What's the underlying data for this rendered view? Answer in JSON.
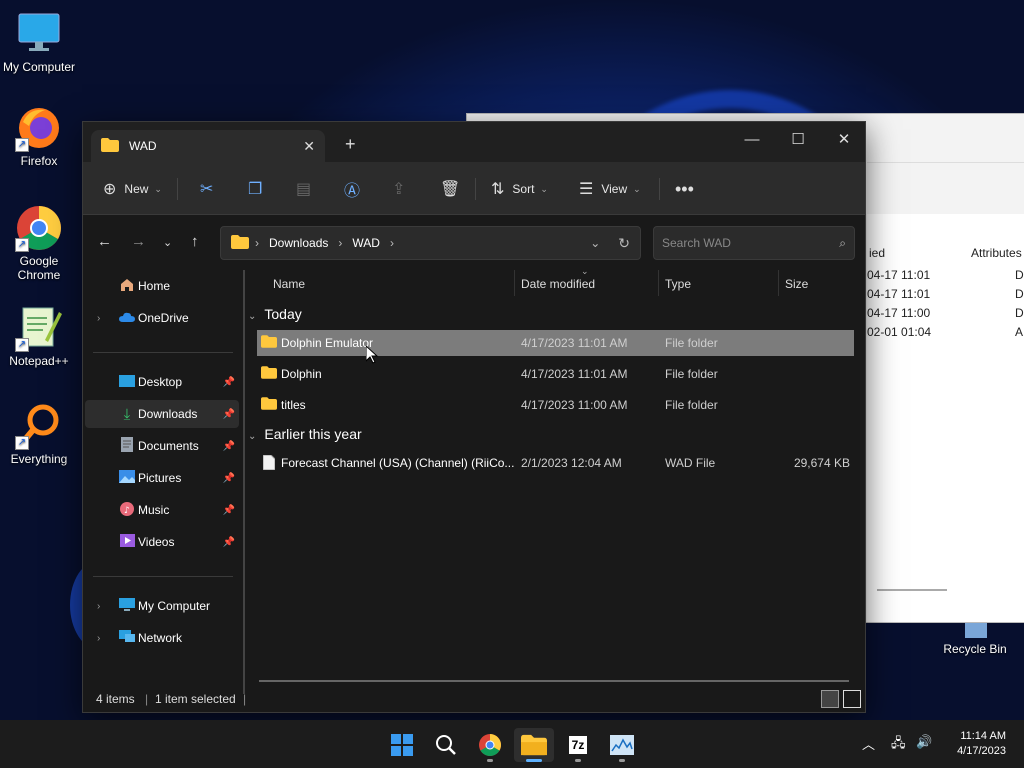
{
  "desktop": {
    "icons": [
      {
        "label": "My Computer"
      },
      {
        "label": "Firefox"
      },
      {
        "label": "Google Chrome"
      },
      {
        "label": "Notepad++"
      },
      {
        "label": "Everything"
      },
      {
        "label": "Recycle Bin"
      }
    ]
  },
  "background_window": {
    "headers": [
      "ied",
      "Attributes"
    ],
    "rows": [
      {
        "date": "04-17 11:01",
        "attr": "D"
      },
      {
        "date": "04-17 11:01",
        "attr": "D"
      },
      {
        "date": "04-17 11:00",
        "attr": "D"
      },
      {
        "date": "02-01 01:04",
        "attr": "A"
      }
    ]
  },
  "explorer": {
    "tab_title": "WAD",
    "toolbar": {
      "new_label": "New",
      "sort_label": "Sort",
      "view_label": "View"
    },
    "address": {
      "segments": [
        "Downloads",
        "WAD"
      ]
    },
    "search": {
      "placeholder": "Search WAD"
    },
    "sidebar": {
      "home": "Home",
      "onedrive": "OneDrive",
      "quick": [
        "Desktop",
        "Downloads",
        "Documents",
        "Pictures",
        "Music",
        "Videos"
      ],
      "my_computer": "My Computer",
      "network": "Network"
    },
    "columns": {
      "name": "Name",
      "date": "Date modified",
      "type": "Type",
      "size": "Size"
    },
    "groups": [
      {
        "title": "Today",
        "files": [
          {
            "name": "Dolphin Emulator",
            "date": "4/17/2023 11:01 AM",
            "type": "File folder",
            "size": ""
          },
          {
            "name": "Dolphin",
            "date": "4/17/2023 11:01 AM",
            "type": "File folder",
            "size": ""
          },
          {
            "name": "titles",
            "date": "4/17/2023 11:00 AM",
            "type": "File folder",
            "size": ""
          }
        ]
      },
      {
        "title": "Earlier this year",
        "files": [
          {
            "name": "Forecast Channel (USA) (Channel) (RiiCo...",
            "date": "2/1/2023 12:04 AM",
            "type": "WAD File",
            "size": "29,674 KB"
          }
        ]
      }
    ],
    "status": {
      "count": "4 items",
      "selection": "1 item selected"
    }
  },
  "taskbar": {
    "clock_time": "11:14 AM",
    "clock_date": "4/17/2023",
    "sevenzip_label": "7z"
  }
}
